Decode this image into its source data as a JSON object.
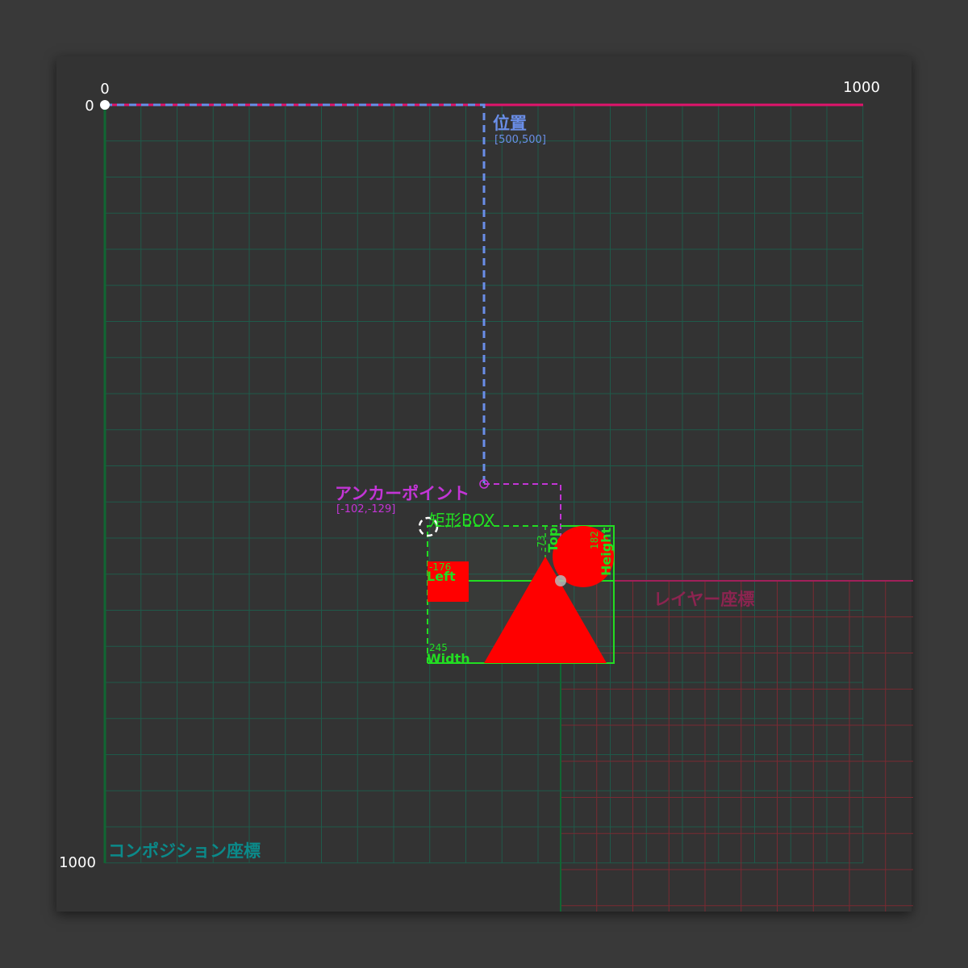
{
  "composition": {
    "label": "コンポジション座標",
    "axis_x_start": "0",
    "axis_x_end": "1000",
    "axis_y_start": "0",
    "axis_y_end": "1000",
    "color": "#0b8a8a",
    "grid_color": "#1d5c4c",
    "axis_color": "#e0146c"
  },
  "layer": {
    "label": "レイヤー座標",
    "grid_color": "#8a2a34",
    "label_color": "#8c2450"
  },
  "position": {
    "label": "位置",
    "value": "[500,500]",
    "color": "#6a8ee8"
  },
  "anchor_point": {
    "label": "アンカーポイント",
    "value": "[-102,-129]",
    "color": "#c335d6"
  },
  "rect_box": {
    "label": "矩形BOX",
    "left_value": "-176",
    "left_label": "Left",
    "top_value": "-73",
    "top_label": "Top",
    "width_value": "245",
    "width_label": "Width",
    "height_value": "182",
    "height_label": "Height",
    "color": "#22dd22"
  },
  "shapes_color": "#ff0000"
}
